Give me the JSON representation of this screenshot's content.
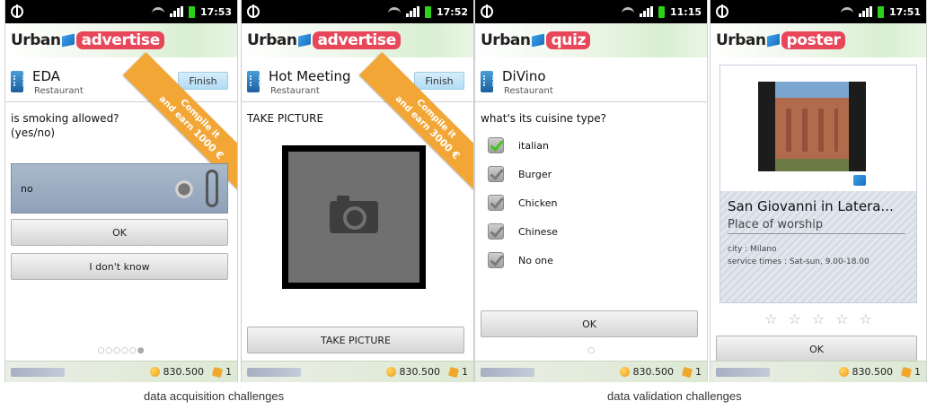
{
  "screens": [
    {
      "time": "17:53",
      "logo": {
        "brand": "Urban",
        "tag": "advertise",
        "tag_color": "#e8475a"
      },
      "venue": {
        "name": "EDA",
        "type": "Restaurant"
      },
      "finish_label": "Finish",
      "question": "is smoking allowed? (yes/no)",
      "ribbon": {
        "line1": "Compile it",
        "line2": "and earn",
        "amount": "1000 €"
      },
      "answer_value": "no",
      "buttons": [
        "OK",
        "I don't know"
      ],
      "pager": "○○○○○●",
      "footer": {
        "score": "830.500",
        "cubes": "1"
      }
    },
    {
      "time": "17:52",
      "logo": {
        "brand": "Urban",
        "tag": "advertise",
        "tag_color": "#e8475a"
      },
      "venue": {
        "name": "Hot Meeting",
        "type": "Restaurant"
      },
      "finish_label": "Finish",
      "question": "TAKE PICTURE",
      "ribbon": {
        "line1": "Compile it",
        "line2": "and earn",
        "amount": "3000 €"
      },
      "button": "TAKE PICTURE",
      "footer": {
        "score": "830.500",
        "cubes": "1"
      }
    },
    {
      "time": "11:15",
      "logo": {
        "brand": "Urban",
        "tag": "quiz",
        "tag_color": "#e8475a"
      },
      "venue": {
        "name": "DiVino",
        "type": "Restaurant"
      },
      "question": "what's its cuisine type?",
      "options": [
        {
          "label": "italian",
          "checked": true
        },
        {
          "label": "Burger",
          "checked": false
        },
        {
          "label": "Chicken",
          "checked": false
        },
        {
          "label": "Chinese",
          "checked": false
        },
        {
          "label": "No one",
          "checked": false
        }
      ],
      "button": "OK",
      "scroll_dot": "○",
      "footer": {
        "score": "830.500",
        "cubes": "1"
      }
    },
    {
      "time": "17:51",
      "logo": {
        "brand": "Urban",
        "tag": "poster",
        "tag_color": "#e8475a"
      },
      "poster": {
        "title": "San Giovanni in Latera...",
        "subtitle": "Place of worship",
        "city": "city : Milano",
        "service_times": "service times : Sat-sun, 9.00-18.00"
      },
      "stars": [
        "☆",
        "☆",
        "☆",
        "☆",
        "☆"
      ],
      "button": "OK",
      "footer": {
        "score": "830.500",
        "cubes": "1"
      }
    }
  ],
  "captions": {
    "left": "data acquisition challenges",
    "right": "data validation challenges"
  },
  "colors": {
    "ribbon": "#f2a636",
    "checked": "#43c31c",
    "finish": "#b2dcf4"
  }
}
